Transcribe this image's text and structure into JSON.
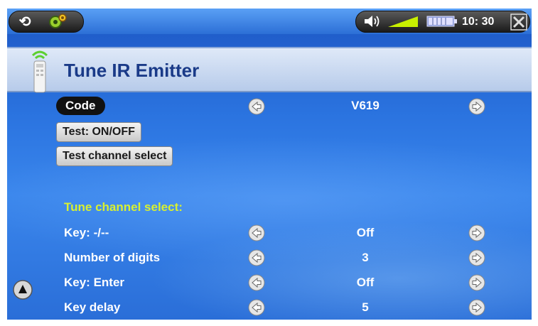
{
  "status_bar": {
    "time": "10: 30"
  },
  "header": {
    "title": "Tune IR Emitter"
  },
  "code_row": {
    "label": "Code",
    "value": "V619"
  },
  "buttons": {
    "test_on_off": "Test: ON/OFF",
    "test_channel_select": "Test channel select"
  },
  "section_title": "Tune channel select:",
  "settings": [
    {
      "label": "Key: -/--",
      "value": "Off"
    },
    {
      "label": "Number of digits",
      "value": "3"
    },
    {
      "label": "Key: Enter",
      "value": "Off"
    },
    {
      "label": "Key delay",
      "value": "5"
    }
  ],
  "colors": {
    "accent_section": "#d8f030",
    "title_text": "#1a3a88",
    "volume_bar": "#c8f000",
    "battery": "#e0e0ff"
  },
  "icons": {
    "sync": "sync-icon",
    "settings": "gear-icon",
    "speaker": "speaker-icon",
    "close": "close-icon",
    "remote": "remote-icon",
    "arrow_left": "arrow-left-icon",
    "arrow_right": "arrow-right-icon",
    "scroll_up": "up-icon"
  }
}
